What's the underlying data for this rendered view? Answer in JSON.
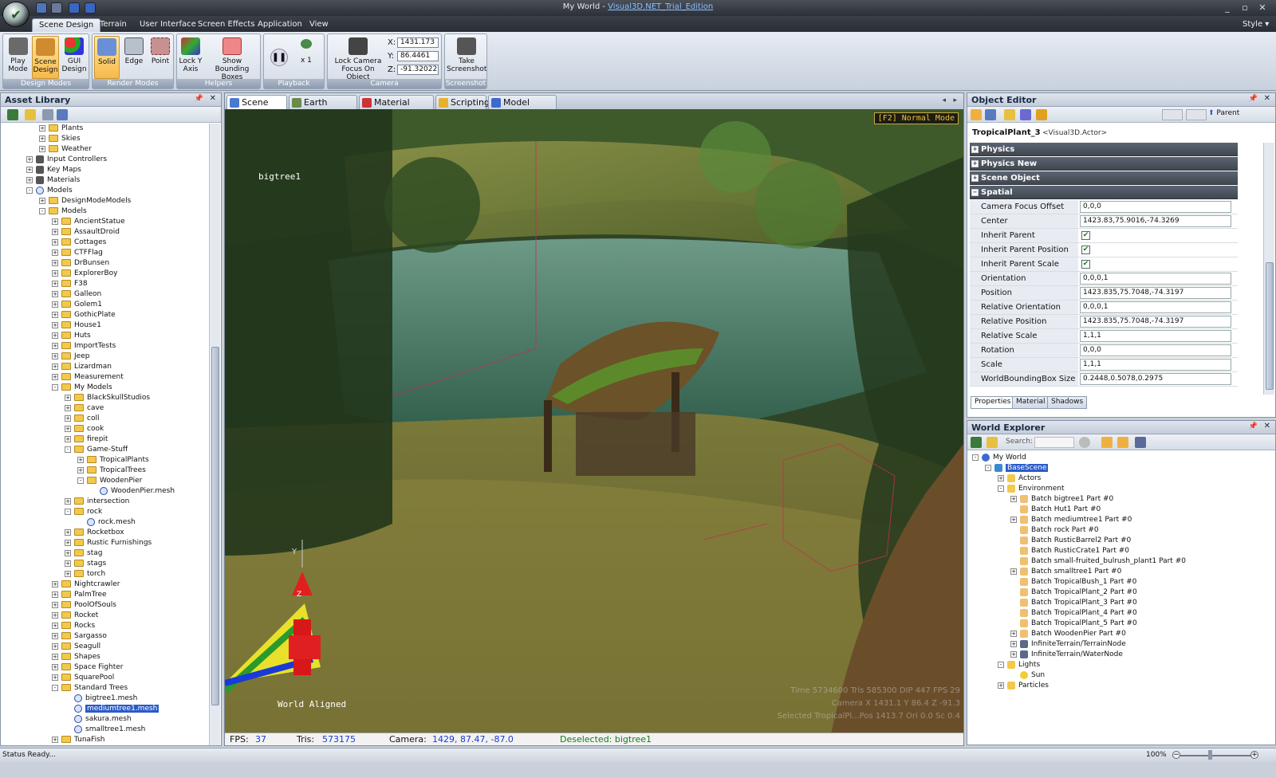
{
  "window": {
    "title_prefix": "My World - ",
    "title_link": "Visual3D.NET_Trial_Edition"
  },
  "menu": {
    "tabs": [
      "Scene Design",
      "Terrain",
      "User Interface",
      "Screen Effects",
      "Application",
      "View"
    ],
    "style": "Style"
  },
  "ribbon": {
    "design_modes": {
      "label": "Design Modes",
      "buttons": [
        "Play\nMode",
        "Scene\nDesign",
        "GUI\nDesign"
      ]
    },
    "render_modes": {
      "label": "Render Modes",
      "buttons": [
        "Solid",
        "Edge",
        "Point"
      ]
    },
    "helpers": {
      "label": "Helpers",
      "buttons": [
        "Lock Y\nAxis",
        "Show Bounding\nBoxes"
      ]
    },
    "playback": {
      "label": "Playback",
      "speed": "x 1"
    },
    "camera": {
      "label": "Camera",
      "lock_label": "Lock Camera\nFocus On Object",
      "x_label": "X:",
      "y_label": "Y:",
      "z_label": "Z:",
      "x": "1431.173",
      "y": "86.4461",
      "z": "-91.32022"
    },
    "screenshot": {
      "label": "Screenshot",
      "button": "Take\nScreenshot"
    }
  },
  "asset_library": {
    "title": "Asset Library"
  },
  "asset_tree": [
    [
      "Plants",
      2,
      "f",
      "+"
    ],
    [
      "Skies",
      2,
      "f",
      "+"
    ],
    [
      "Weather",
      2,
      "f",
      "+"
    ],
    [
      "Input Controllers",
      1,
      "o",
      "+"
    ],
    [
      "Key Maps",
      1,
      "o",
      "+"
    ],
    [
      "Materials",
      1,
      "o",
      "+"
    ],
    [
      "Models",
      1,
      "m",
      "-"
    ],
    [
      "DesignModeModels",
      2,
      "f",
      "+"
    ],
    [
      "Models",
      2,
      "f",
      "-"
    ],
    [
      "AncientStatue",
      3,
      "f",
      "+"
    ],
    [
      "AssaultDroid",
      3,
      "f",
      "+"
    ],
    [
      "Cottages",
      3,
      "f",
      "+"
    ],
    [
      "CTFFlag",
      3,
      "f",
      "+"
    ],
    [
      "DrBunsen",
      3,
      "f",
      "+"
    ],
    [
      "ExplorerBoy",
      3,
      "f",
      "+"
    ],
    [
      "F38",
      3,
      "f",
      "+"
    ],
    [
      "Galleon",
      3,
      "f",
      "+"
    ],
    [
      "Golem1",
      3,
      "f",
      "+"
    ],
    [
      "GothicPlate",
      3,
      "f",
      "+"
    ],
    [
      "House1",
      3,
      "f",
      "+"
    ],
    [
      "Huts",
      3,
      "f",
      "+"
    ],
    [
      "ImportTests",
      3,
      "f",
      "+"
    ],
    [
      "Jeep",
      3,
      "f",
      "+"
    ],
    [
      "Lizardman",
      3,
      "f",
      "+"
    ],
    [
      "Measurement",
      3,
      "f",
      "+"
    ],
    [
      "My Models",
      3,
      "f",
      "-"
    ],
    [
      "BlackSkullStudios",
      4,
      "f",
      "+"
    ],
    [
      "cave",
      4,
      "f",
      "+"
    ],
    [
      "coll",
      4,
      "f",
      "+"
    ],
    [
      "cook",
      4,
      "f",
      "+"
    ],
    [
      "firepit",
      4,
      "f",
      "+"
    ],
    [
      "Game-Stuff",
      4,
      "f",
      "-"
    ],
    [
      "TropicalPlants",
      5,
      "f",
      "+"
    ],
    [
      "TropicalTrees",
      5,
      "f",
      "+"
    ],
    [
      "WoodenPier",
      5,
      "f",
      "-"
    ],
    [
      "WoodenPier.mesh",
      6,
      "m",
      ""
    ],
    [
      "intersection",
      4,
      "f",
      "+"
    ],
    [
      "rock",
      4,
      "f",
      "-"
    ],
    [
      "rock.mesh",
      5,
      "m",
      ""
    ],
    [
      "Rocketbox",
      4,
      "f",
      "+"
    ],
    [
      "Rustic Furnishings",
      4,
      "f",
      "+"
    ],
    [
      "stag",
      4,
      "f",
      "+"
    ],
    [
      "stags",
      4,
      "f",
      "+"
    ],
    [
      "torch",
      4,
      "f",
      "+"
    ],
    [
      "Nightcrawler",
      3,
      "f",
      "+"
    ],
    [
      "PalmTree",
      3,
      "f",
      "+"
    ],
    [
      "PoolOfSouls",
      3,
      "f",
      "+"
    ],
    [
      "Rocket",
      3,
      "f",
      "+"
    ],
    [
      "Rocks",
      3,
      "f",
      "+"
    ],
    [
      "Sargasso",
      3,
      "f",
      "+"
    ],
    [
      "Seagull",
      3,
      "f",
      "+"
    ],
    [
      "Shapes",
      3,
      "f",
      "+"
    ],
    [
      "Space Fighter",
      3,
      "f",
      "+"
    ],
    [
      "SquarePool",
      3,
      "f",
      "+"
    ],
    [
      "Standard Trees",
      3,
      "f",
      "-"
    ],
    [
      "bigtree1.mesh",
      4,
      "m",
      ""
    ],
    [
      "mediumtree1.mesh",
      4,
      "m",
      ""
    ],
    [
      "sakura.mesh",
      4,
      "m",
      ""
    ],
    [
      "smalltree1.mesh",
      4,
      "m",
      ""
    ],
    [
      "TunaFish",
      3,
      "f",
      "+"
    ]
  ],
  "asset_selected": "mediumtree1.mesh",
  "doc_tabs": [
    "Scene View",
    "Earth Builder",
    "Material Editor",
    "Scripting",
    "Model Editor"
  ],
  "viewport": {
    "mode_badge": "[F2] Normal Mode",
    "object_label": "bigtree1",
    "gizmo_label": "World Aligned",
    "axis_y": "Y",
    "axis_z": "Z",
    "overlay_line1": "Time 5734600  Tris 585300  DIP 447  FPS 29",
    "overlay_line2": "Camera  X 1431.1  Y 86.4  Z -91.3",
    "overlay_line3": "Selected TropicalPl...Pos 1413.7 Ori 0.0 Sc 0.4"
  },
  "view_status": {
    "fps_label": "FPS:",
    "fps": "37",
    "tris_label": "Tris:",
    "tris": "573175",
    "camera_label": "Camera:",
    "camera": "1429, 87.47, -87.0",
    "message": "Deselected: bigtree1"
  },
  "object_editor": {
    "title": "Object Editor",
    "parent": "Parent",
    "object_name": "TropicalPlant_3",
    "object_type": "<Visual3D.Actor>",
    "categories": [
      "Physics",
      "Physics New",
      "Scene Object",
      "Spatial"
    ],
    "props": [
      {
        "name": "Camera Focus Offset",
        "value": "0,0,0",
        "exp": true
      },
      {
        "name": "Center",
        "value": "1423.83,75.9016,-74.3269",
        "exp": true
      },
      {
        "name": "Inherit Parent Orientation",
        "check": true
      },
      {
        "name": "Inherit Parent Position",
        "check": true
      },
      {
        "name": "Inherit Parent Scale",
        "check": true
      },
      {
        "name": "Orientation",
        "value": "0,0,0,1",
        "exp": true
      },
      {
        "name": "Position",
        "value": "1423.835,75.7048,-74.3197",
        "exp": true
      },
      {
        "name": "Relative Orientation",
        "value": "0,0,0,1",
        "exp": true
      },
      {
        "name": "Relative Position",
        "value": "1423.835,75.7048,-74.3197",
        "exp": true
      },
      {
        "name": "Relative Scale",
        "value": "1,1,1",
        "exp": true
      },
      {
        "name": "Rotation",
        "value": "0,0,0",
        "exp": true
      },
      {
        "name": "Scale",
        "value": "1,1,1",
        "exp": true
      },
      {
        "name": "WorldBoundingBox Size",
        "value": "0.2448,0.5078,0.2975",
        "exp": true
      }
    ],
    "bottom_tabs": [
      "Properties",
      "Material",
      "Shadows"
    ]
  },
  "world_explorer": {
    "title": "World Explorer",
    "search_label": "Search:"
  },
  "world_tree": [
    [
      "My World",
      0,
      "w",
      "-"
    ],
    [
      "BaseScene",
      1,
      "s",
      "-"
    ],
    [
      "Actors",
      2,
      "f",
      "+"
    ],
    [
      "Environment",
      2,
      "f",
      "-"
    ],
    [
      "Batch bigtree1 Part #0",
      3,
      "b",
      "+"
    ],
    [
      "Batch Hut1 Part #0",
      3,
      "b",
      ""
    ],
    [
      "Batch mediumtree1 Part #0",
      3,
      "b",
      "+"
    ],
    [
      "Batch rock Part #0",
      3,
      "b",
      ""
    ],
    [
      "Batch RusticBarrel2 Part #0",
      3,
      "b",
      ""
    ],
    [
      "Batch RusticCrate1 Part #0",
      3,
      "b",
      ""
    ],
    [
      "Batch small-fruited_bulrush_plant1 Part #0",
      3,
      "b",
      ""
    ],
    [
      "Batch smalltree1 Part #0",
      3,
      "b",
      "+"
    ],
    [
      "Batch TropicalBush_1 Part #0",
      3,
      "b",
      ""
    ],
    [
      "Batch TropicalPlant_2 Part #0",
      3,
      "b",
      ""
    ],
    [
      "Batch TropicalPlant_3 Part #0",
      3,
      "b",
      ""
    ],
    [
      "Batch TropicalPlant_4 Part #0",
      3,
      "b",
      ""
    ],
    [
      "Batch TropicalPlant_5 Part #0",
      3,
      "b",
      ""
    ],
    [
      "Batch WoodenPier Part #0",
      3,
      "b",
      "+"
    ],
    [
      "InfiniteTerrain/TerrainNode",
      3,
      "t",
      "+"
    ],
    [
      "InfiniteTerrain/WaterNode",
      3,
      "t",
      "+"
    ],
    [
      "Lights",
      2,
      "f",
      "-"
    ],
    [
      "Sun",
      3,
      "l",
      ""
    ],
    [
      "Particles",
      2,
      "f",
      "+"
    ]
  ],
  "world_selected": "BaseScene",
  "statusbar": {
    "text": "Status Ready...",
    "zoom": "100%"
  }
}
